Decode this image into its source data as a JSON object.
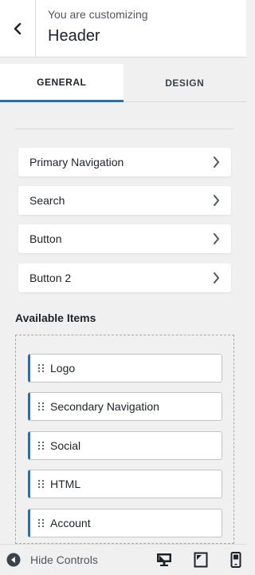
{
  "header": {
    "subtitle": "You are customizing",
    "title": "Header"
  },
  "tabs": [
    {
      "label": "GENERAL",
      "active": true
    },
    {
      "label": "DESIGN",
      "active": false
    }
  ],
  "header_items": [
    {
      "label": "Primary Navigation"
    },
    {
      "label": "Search"
    },
    {
      "label": "Button"
    },
    {
      "label": "Button 2"
    }
  ],
  "available": {
    "heading": "Available Items",
    "items": [
      {
        "label": "Logo"
      },
      {
        "label": "Secondary Navigation"
      },
      {
        "label": "Social"
      },
      {
        "label": "HTML"
      },
      {
        "label": "Account"
      }
    ]
  },
  "footer": {
    "hide_label": "Hide Controls",
    "devices": [
      "desktop-icon",
      "tablet-icon",
      "mobile-icon"
    ]
  },
  "colors": {
    "accent": "#2271b1",
    "background": "#f0f0f1",
    "text": "#1d2327"
  }
}
